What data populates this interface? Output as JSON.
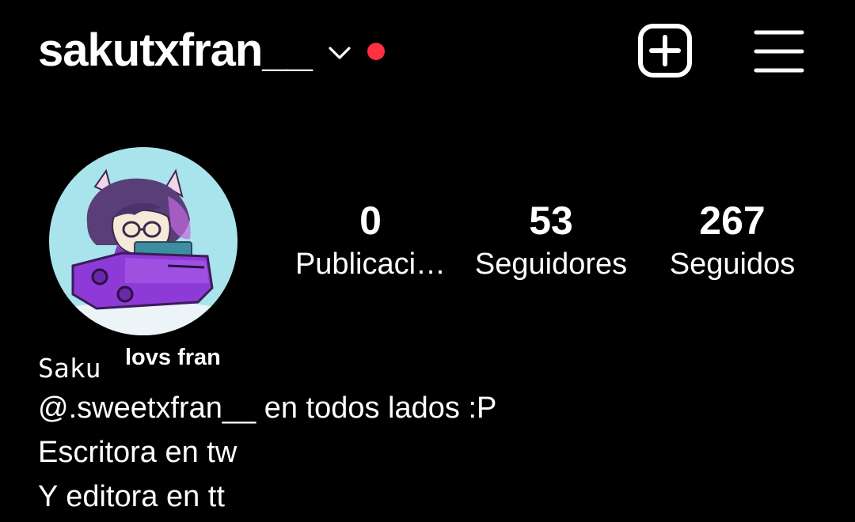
{
  "header": {
    "username": "sakutxfran__",
    "chevron_icon": "chevron-down-icon",
    "notification_dot_color": "#ff3040",
    "add_icon": "plus-square-icon",
    "menu_icon": "hamburger-menu-icon"
  },
  "profile": {
    "avatar_icon": "profile-avatar-image",
    "stats": [
      {
        "value": "0",
        "label": "Publicaci…"
      },
      {
        "value": "53",
        "label": "Seguidores"
      },
      {
        "value": "267",
        "label": "Seguidos"
      }
    ]
  },
  "bio": {
    "name": "Saku",
    "name_suffix": "lovs fran",
    "lines": [
      "@.sweetxfran__ en todos lados :P",
      "Escritora en tw",
      "Y editora en tt"
    ]
  },
  "colors": {
    "background": "#000000",
    "text": "#ffffff",
    "notification": "#ff3040"
  }
}
